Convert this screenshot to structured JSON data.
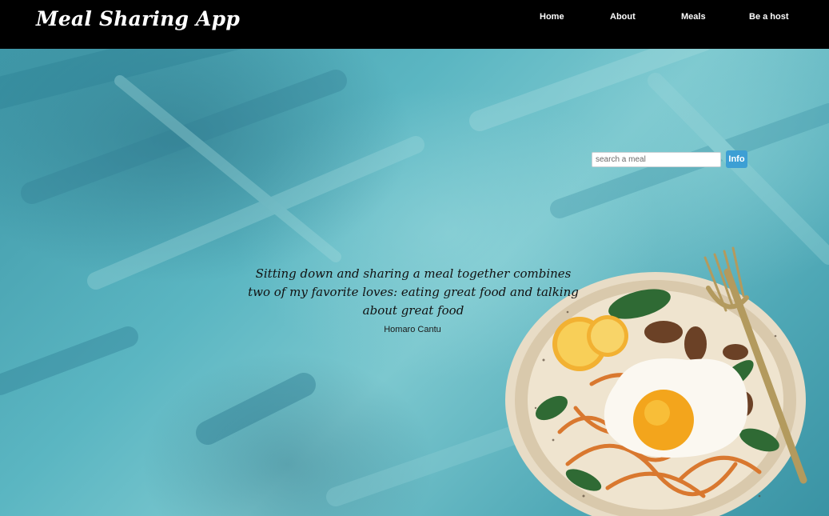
{
  "navbar": {
    "brand": "Meal Sharing App",
    "links": [
      {
        "label": "Home"
      },
      {
        "label": "About"
      },
      {
        "label": "Meals"
      },
      {
        "label": "Be a host"
      }
    ]
  },
  "search": {
    "placeholder": "search a meal",
    "value": "",
    "button_label": "Info"
  },
  "quote": {
    "text": "Sitting down and sharing a meal together combines two of my favorite loves: eating great food and talking about great food",
    "author": "Homaro Cantu"
  },
  "colors": {
    "navbar_bg": "#000000",
    "hero_teal": "#5bb6c2",
    "info_button": "#3d9fd4"
  }
}
